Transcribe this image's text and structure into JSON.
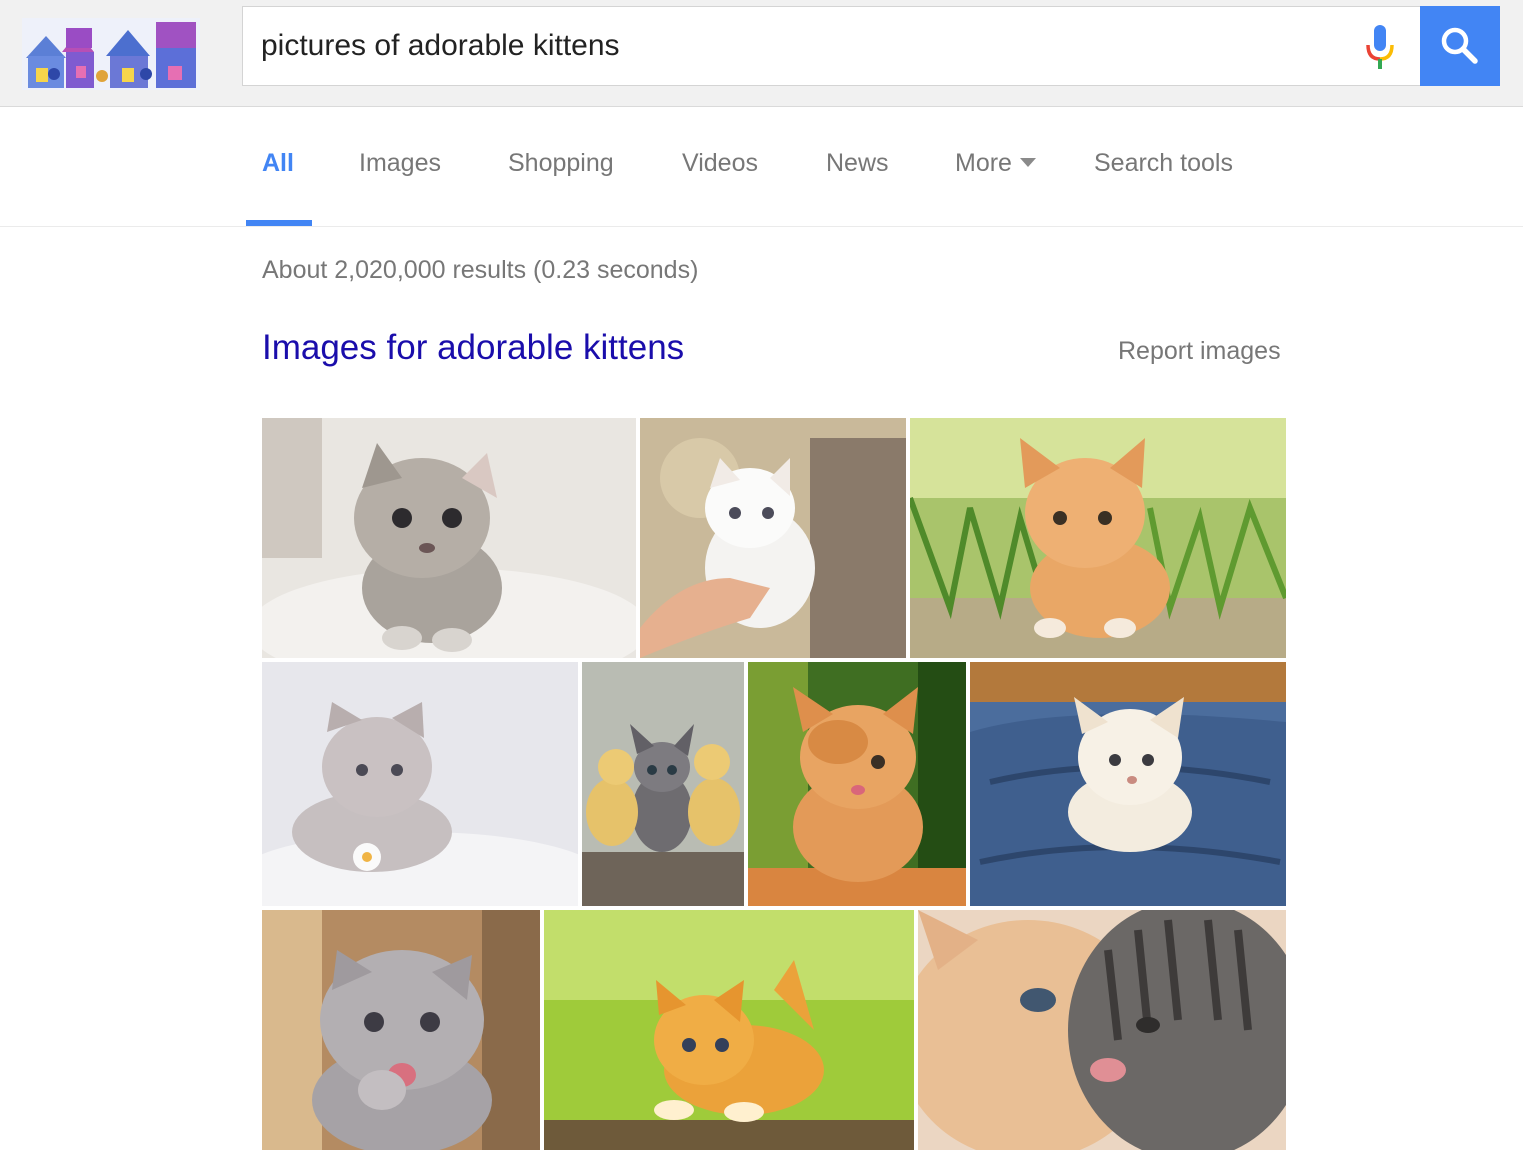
{
  "search": {
    "query": "pictures of adorable kittens"
  },
  "tabs": [
    {
      "label": "All",
      "active": true
    },
    {
      "label": "Images"
    },
    {
      "label": "Shopping"
    },
    {
      "label": "Videos"
    },
    {
      "label": "News"
    },
    {
      "label": "More"
    },
    {
      "label": "Search tools"
    }
  ],
  "results": {
    "stats": "About 2,020,000 results (0.23 seconds)",
    "images_heading": "Images for adorable kittens",
    "report_images": "Report images"
  },
  "colors": {
    "accent": "#4285f4",
    "link": "#1a0dab",
    "muted_text": "#777777",
    "header_bg": "#f1f1f1"
  },
  "icons": {
    "mic": "microphone-icon",
    "search": "search-icon",
    "more_caret": "caret-down-icon"
  },
  "image_thumbnails": [
    "gray-tabby-kitten-on-blanket",
    "white-kitten-on-hand",
    "orange-kitten-on-grass",
    "gray-fold-kitten-with-daisy",
    "kitten-between-ducklings",
    "orange-kitten-paw-over-eye",
    "white-kitten-in-jeans-pocket",
    "gray-kitten-licking-paw",
    "orange-kitten-on-green",
    "two-kittens-nuzzling"
  ]
}
